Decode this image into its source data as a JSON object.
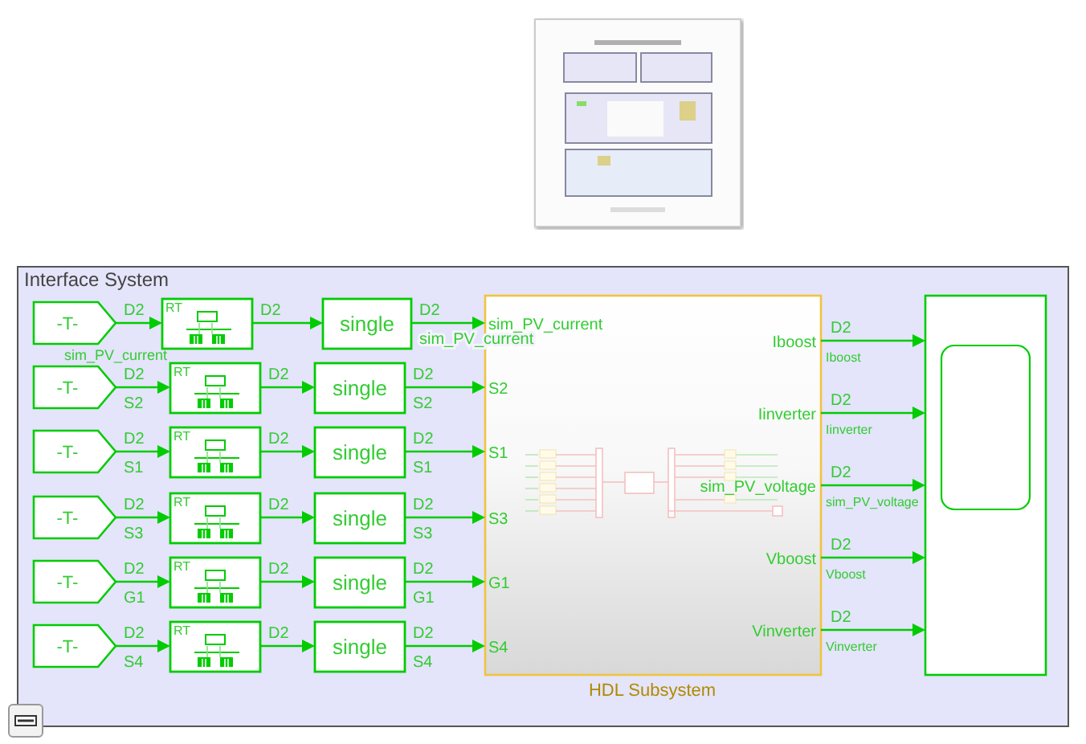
{
  "interface_system": {
    "title": "Interface System",
    "rows": [
      {
        "tag": "-T-",
        "in_type": "D2",
        "in_name": "sim_PV_current",
        "rt_label": "RT",
        "mid_type": "D2",
        "convert": "single",
        "out_type": "D2",
        "out_name": "sim_PV_current",
        "port": "sim_PV_current"
      },
      {
        "tag": "-T-",
        "in_type": "D2",
        "in_name": "S2",
        "rt_label": "RT",
        "mid_type": "D2",
        "convert": "single",
        "out_type": "D2",
        "out_name": "S2",
        "port": "S2"
      },
      {
        "tag": "-T-",
        "in_type": "D2",
        "in_name": "S1",
        "rt_label": "RT",
        "mid_type": "D2",
        "convert": "single",
        "out_type": "D2",
        "out_name": "S1",
        "port": "S1"
      },
      {
        "tag": "-T-",
        "in_type": "D2",
        "in_name": "S3",
        "rt_label": "RT",
        "mid_type": "D2",
        "convert": "single",
        "out_type": "D2",
        "out_name": "S3",
        "port": "S3"
      },
      {
        "tag": "-T-",
        "in_type": "D2",
        "in_name": "G1",
        "rt_label": "RT",
        "mid_type": "D2",
        "convert": "single",
        "out_type": "D2",
        "out_name": "G1",
        "port": "G1"
      },
      {
        "tag": "-T-",
        "in_type": "D2",
        "in_name": "S4",
        "rt_label": "RT",
        "mid_type": "D2",
        "convert": "single",
        "out_type": "D2",
        "out_name": "S4",
        "port": "S4"
      }
    ],
    "hdl_subsystem": {
      "label": "HDL Subsystem",
      "outputs": [
        {
          "port": "Iboost",
          "type": "D2",
          "name": "Iboost"
        },
        {
          "port": "Iinverter",
          "type": "D2",
          "name": "Iinverter"
        },
        {
          "port": "sim_PV_voltage",
          "type": "D2",
          "name": "sim_PV_voltage"
        },
        {
          "port": "Vboost",
          "type": "D2",
          "name": "Vboost"
        },
        {
          "port": "Vinverter",
          "type": "D2",
          "name": "Vinverter"
        }
      ]
    }
  }
}
